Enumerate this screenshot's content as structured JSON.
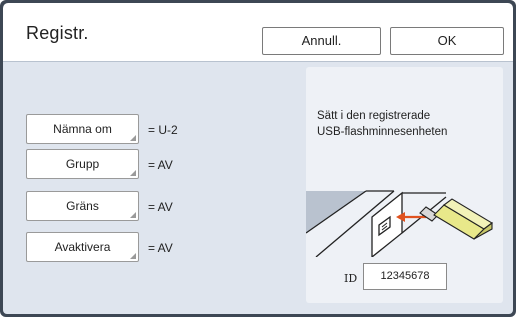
{
  "header": {
    "title": "Registr.",
    "cancel_label": "Annull.",
    "ok_label": "OK"
  },
  "options": [
    {
      "label": "Nämna om",
      "value": "= U-2"
    },
    {
      "label": "Grupp",
      "value": "= AV"
    },
    {
      "label": "Gräns",
      "value": "= AV"
    },
    {
      "label": "Avaktivera",
      "value": "= AV"
    }
  ],
  "panel": {
    "message_line1": "Sätt i den registrerade",
    "message_line2": "USB-flashminnesenheten",
    "id_label": "ID",
    "id_value": "12345678"
  },
  "icons": {
    "usb_illustration": "usb-insert-illustration"
  },
  "colors": {
    "frame": "#3d4754",
    "content_bg": "#dfe5ee",
    "panel_bg": "#eef1f6",
    "arrow": "#e0521f",
    "usb_body": "#e8e88a"
  }
}
